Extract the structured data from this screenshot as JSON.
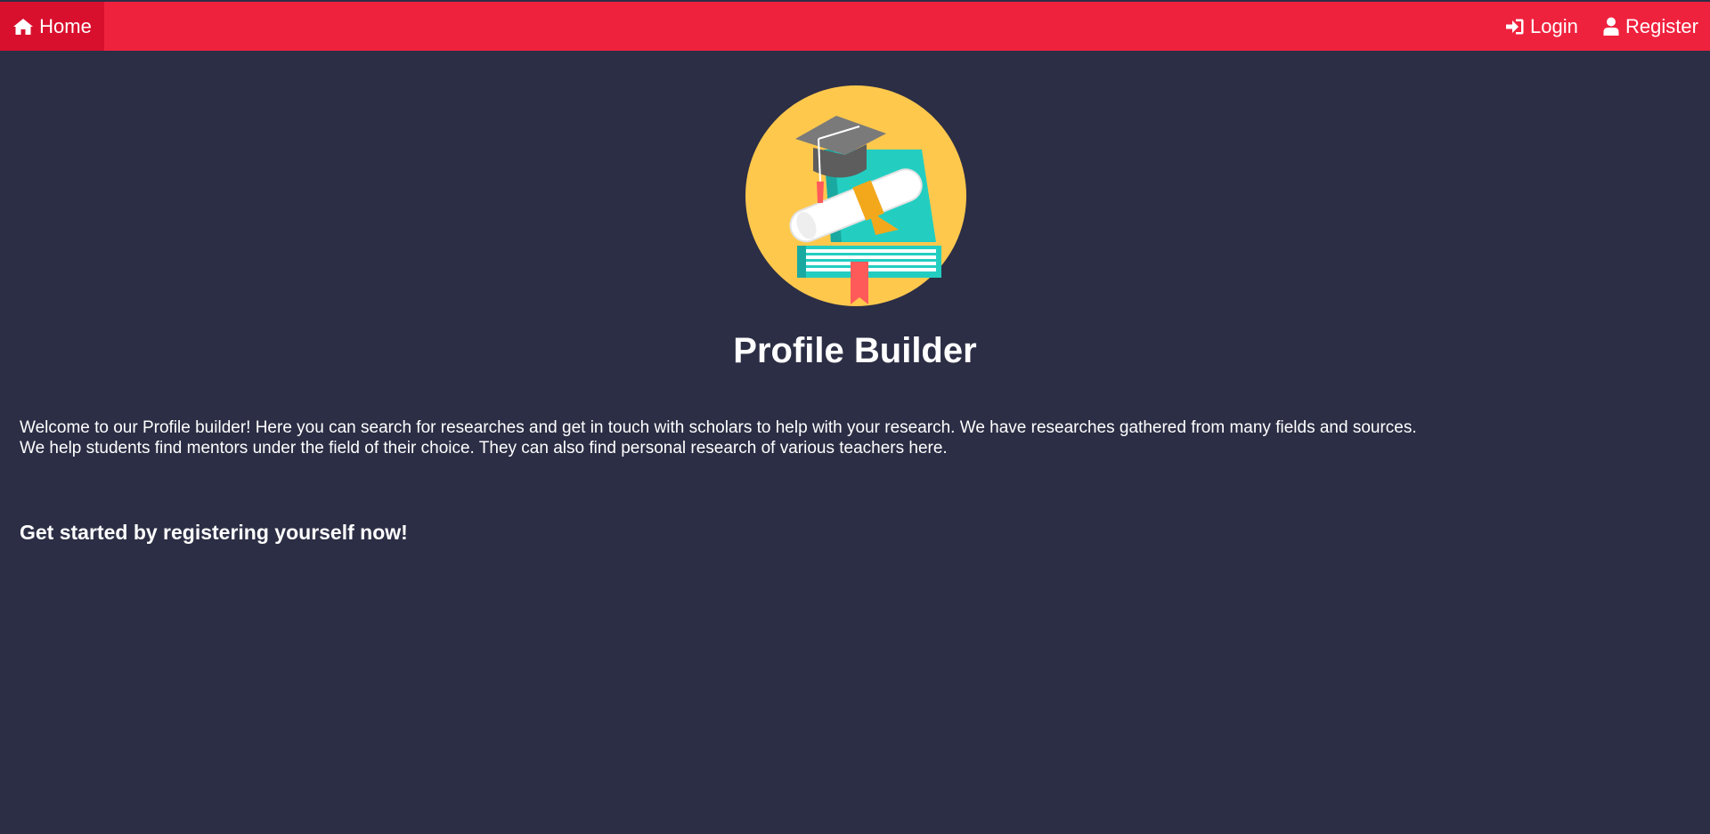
{
  "nav": {
    "home_label": "Home",
    "home_icon": "home-icon",
    "login_label": "Login",
    "login_icon": "sign-in-icon",
    "register_label": "Register",
    "register_icon": "user-icon"
  },
  "hero": {
    "logo_icon": "graduation-books-diploma-logo",
    "title": "Profile Builder"
  },
  "intro": {
    "line1": "Welcome to our Profile builder! Here you can search for researches and get in touch with scholars to help with your research. We have researches gathered from many fields and sources.",
    "line2": "We help students find mentors under the field of their choice. They can also find personal research of various teachers here."
  },
  "cta": {
    "text": "Get started by registering yourself now!"
  },
  "colors": {
    "navbar": "#ef223e",
    "nav_active": "#d8102e",
    "background": "#2c2e45",
    "text": "#ffffff",
    "logo_circle": "#fec84d",
    "book_teal": "#23cec1",
    "cap_gray": "#6f6f6f"
  }
}
